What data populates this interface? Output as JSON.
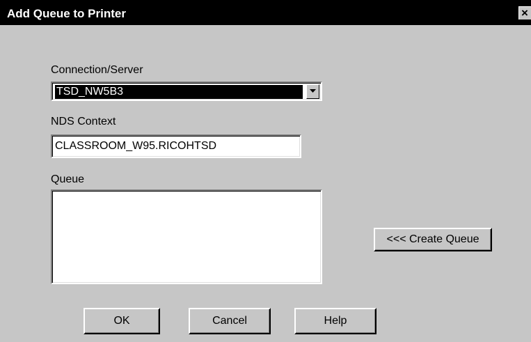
{
  "window": {
    "title": "Add Queue to Printer",
    "close_glyph": "×"
  },
  "form": {
    "connection_label": "Connection/Server",
    "connection_value": "TSD_NW5B3",
    "nds_label": "NDS Context",
    "nds_value": "CLASSROOM_W95.RICOHTSD",
    "queue_label": "Queue",
    "queue_items": []
  },
  "buttons": {
    "create_queue": "<<< Create Queue",
    "ok": "OK",
    "cancel": "Cancel",
    "help": "Help"
  },
  "colors": {
    "dialog_bg": "#c6c6c6",
    "titlebar_bg": "#000000",
    "selection_bg": "#000000"
  },
  "icons": {
    "close": "close-icon",
    "dropdown": "chevron-down-icon"
  }
}
